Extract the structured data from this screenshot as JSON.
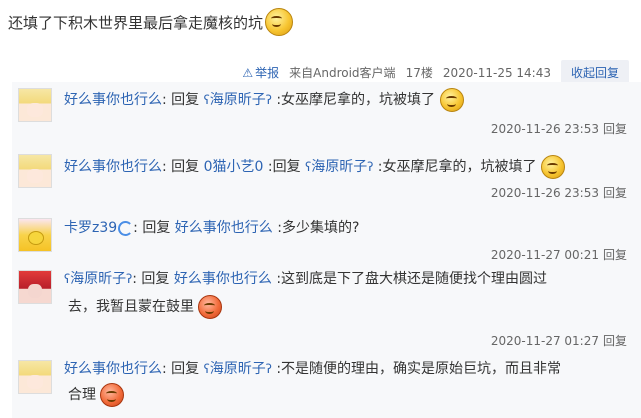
{
  "post": {
    "text": "还填了下积木世界里最后拿走魔核的坑"
  },
  "meta": {
    "report_label": "举报",
    "source": "来自Android客户端",
    "floor": "17楼",
    "time": "2020-11-25 14:43",
    "reply_button": "收起回复"
  },
  "subreplies": [
    {
      "user": "好么事你也行么",
      "sep1": ": 回复 ",
      "target": "海原昕子",
      "content": " :女巫摩尼拿的，坑被填了",
      "time": "2020-11-26 23:53",
      "reply": "回复"
    },
    {
      "user": "好么事你也行么",
      "sep1": ": 回复 ",
      "target": "0猫小艺0",
      "mid": " :回复 ",
      "target2": "海原昕子",
      "content": " :女巫摩尼拿的，坑被填了",
      "time": "2020-11-26 23:53",
      "reply": "回复"
    },
    {
      "user": "卡罗z39",
      "sep1": ": 回复 ",
      "target": "好么事你也行么",
      "content": " :多少集填的?",
      "time": "2020-11-27 00:21",
      "reply": "回复"
    },
    {
      "user": "海原昕子",
      "sep1": ": 回复 ",
      "target": "好么事你也行么",
      "content": " :这到底是下了盘大棋还是随便找个理由圆过",
      "content2": "去，我暂且蒙在鼓里",
      "time": "2020-11-27 01:27",
      "reply": "回复"
    },
    {
      "user": "好么事你也行么",
      "sep1": ": 回复 ",
      "target": "海原昕子",
      "content": " :不是随便的理由，确实是原始巨坑，而且非常",
      "content2": "合理"
    }
  ],
  "vip_glyph": "ʕ",
  "vip_glyph_r": "ʔ"
}
